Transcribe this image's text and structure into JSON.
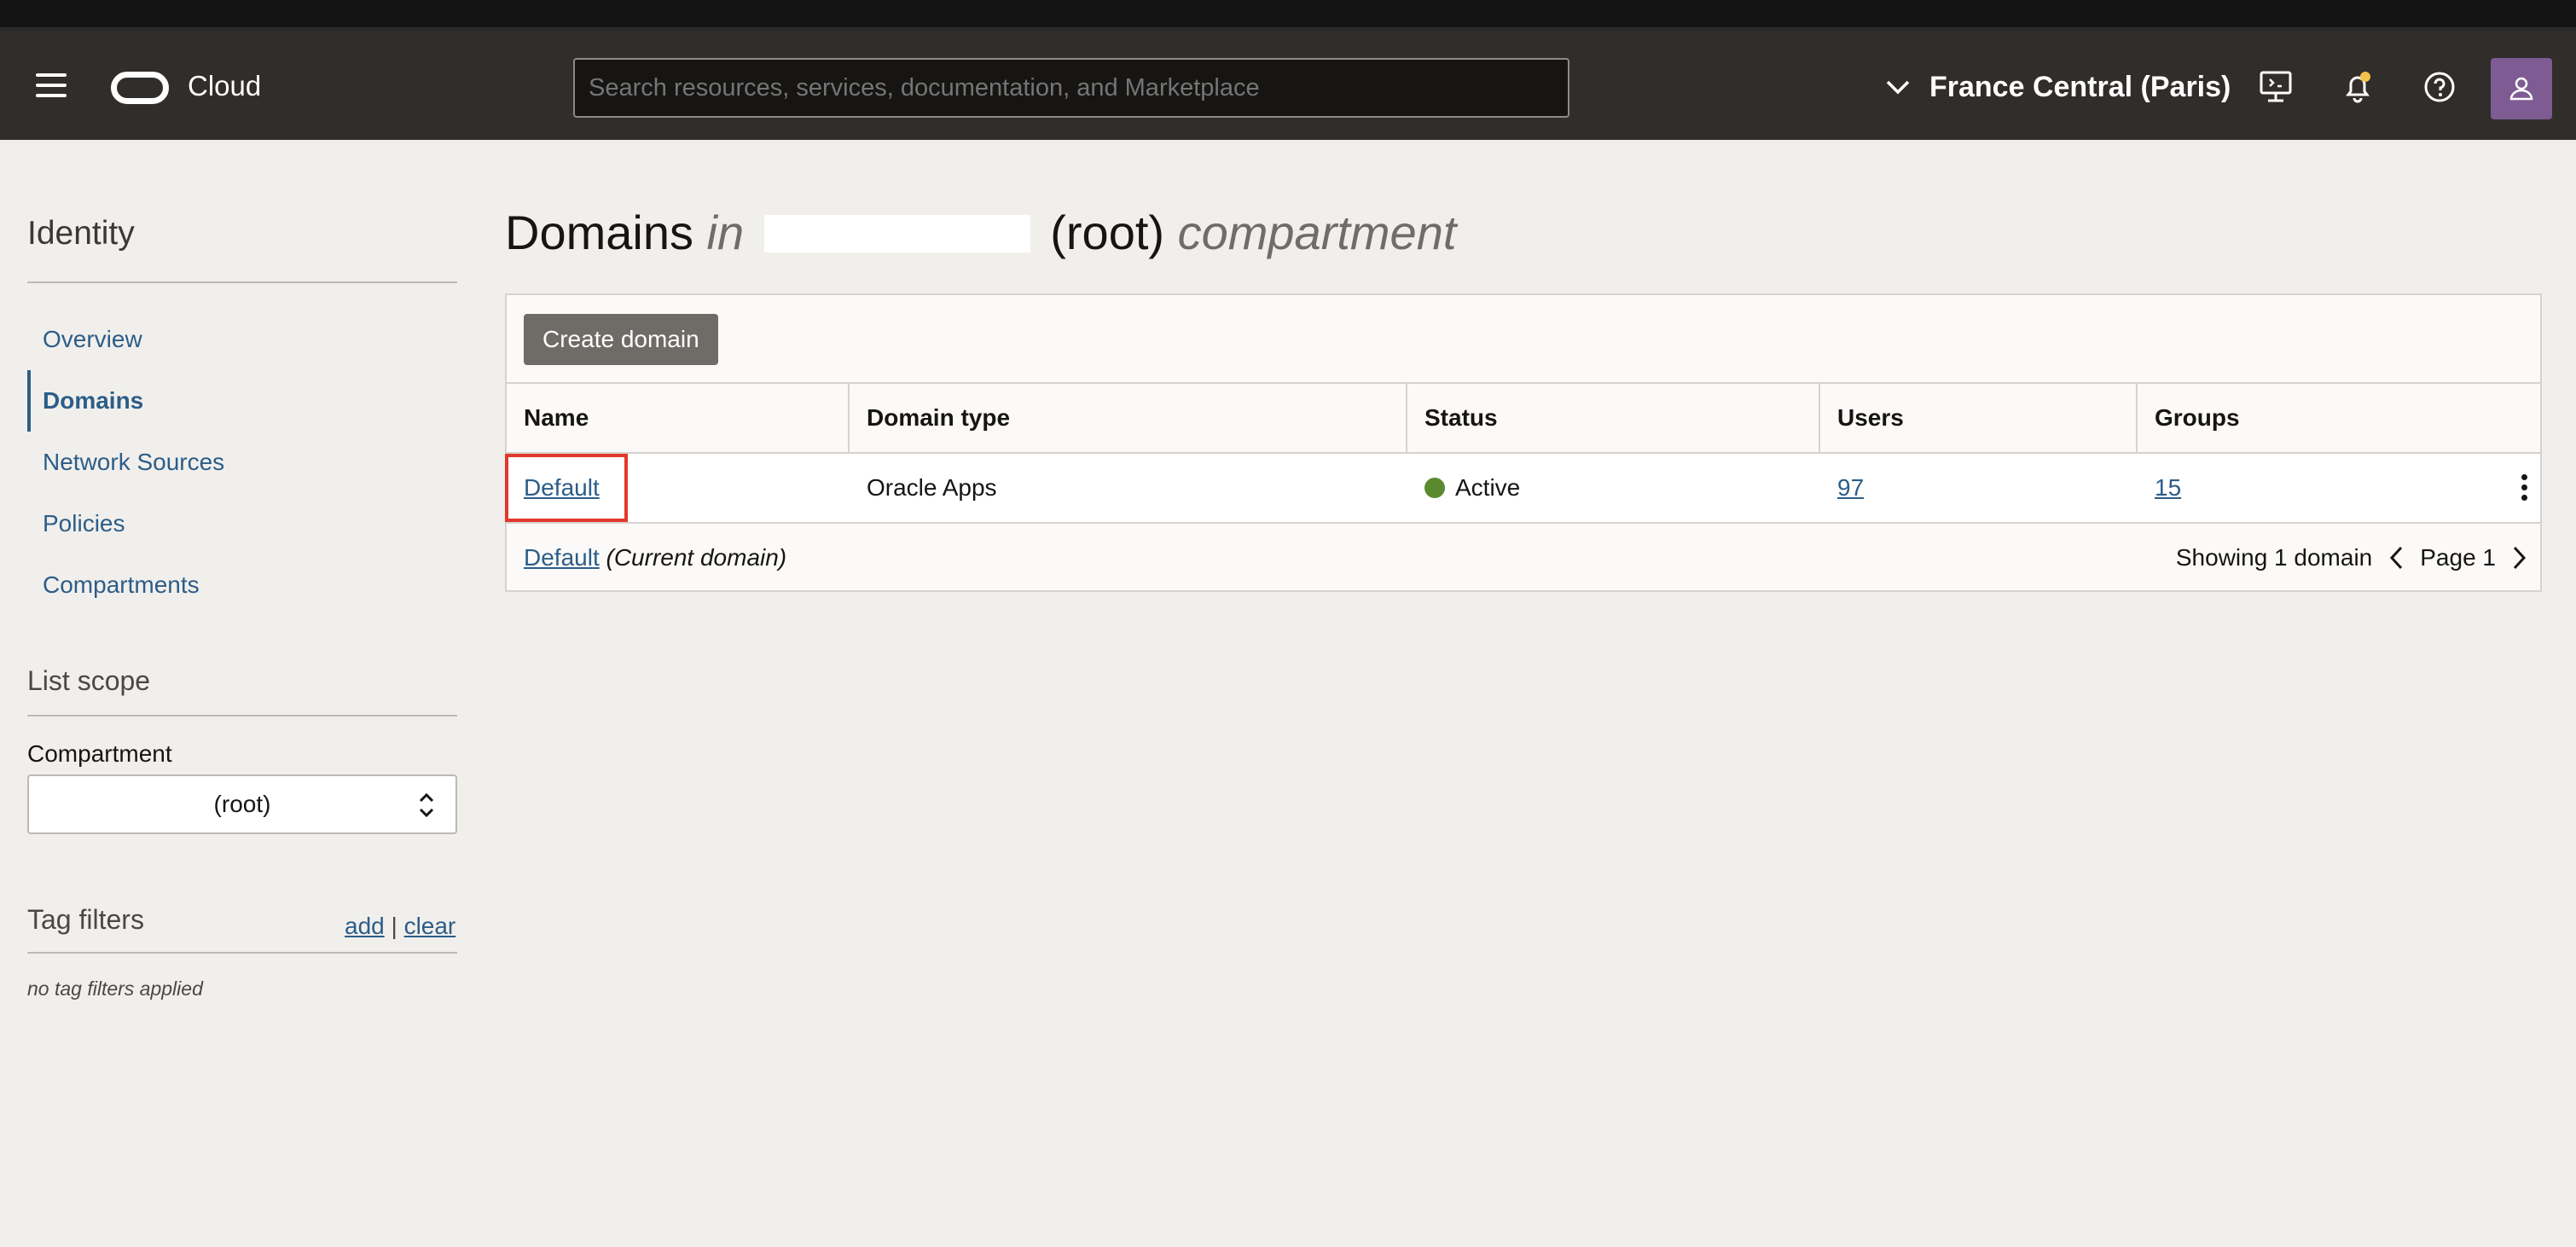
{
  "header": {
    "brand": "Cloud",
    "search_placeholder": "Search resources, services, documentation, and Marketplace",
    "region": "France Central (Paris)"
  },
  "sidebar": {
    "title": "Identity",
    "items": [
      {
        "label": "Overview"
      },
      {
        "label": "Domains"
      },
      {
        "label": "Network Sources"
      },
      {
        "label": "Policies"
      },
      {
        "label": "Compartments"
      }
    ],
    "list_scope": "List scope",
    "compartment_label": "Compartment",
    "compartment_value": "(root)",
    "tag_filters": "Tag filters",
    "tag_add": "add",
    "tag_sep": "|",
    "tag_clear": "clear",
    "no_tags": "no tag filters applied"
  },
  "main": {
    "title_prefix": "Domains",
    "title_in": "in",
    "title_root": "(root)",
    "title_suffix": "compartment",
    "create_button": "Create domain",
    "columns": [
      "Name",
      "Domain type",
      "Status",
      "Users",
      "Groups"
    ],
    "rows": [
      {
        "name": "Default",
        "type": "Oracle Apps",
        "status": "Active",
        "users": "97",
        "groups": "15"
      }
    ],
    "footer": {
      "current_domain": "Default",
      "current_note": "(Current domain)",
      "showing": "Showing 1 domain",
      "page": "Page 1"
    }
  },
  "colors": {
    "header_bg": "#312d2a",
    "link": "#2c5d88",
    "status_active": "#5a8a2e",
    "highlight": "#e0392b",
    "button_bg": "#6f6b67"
  }
}
